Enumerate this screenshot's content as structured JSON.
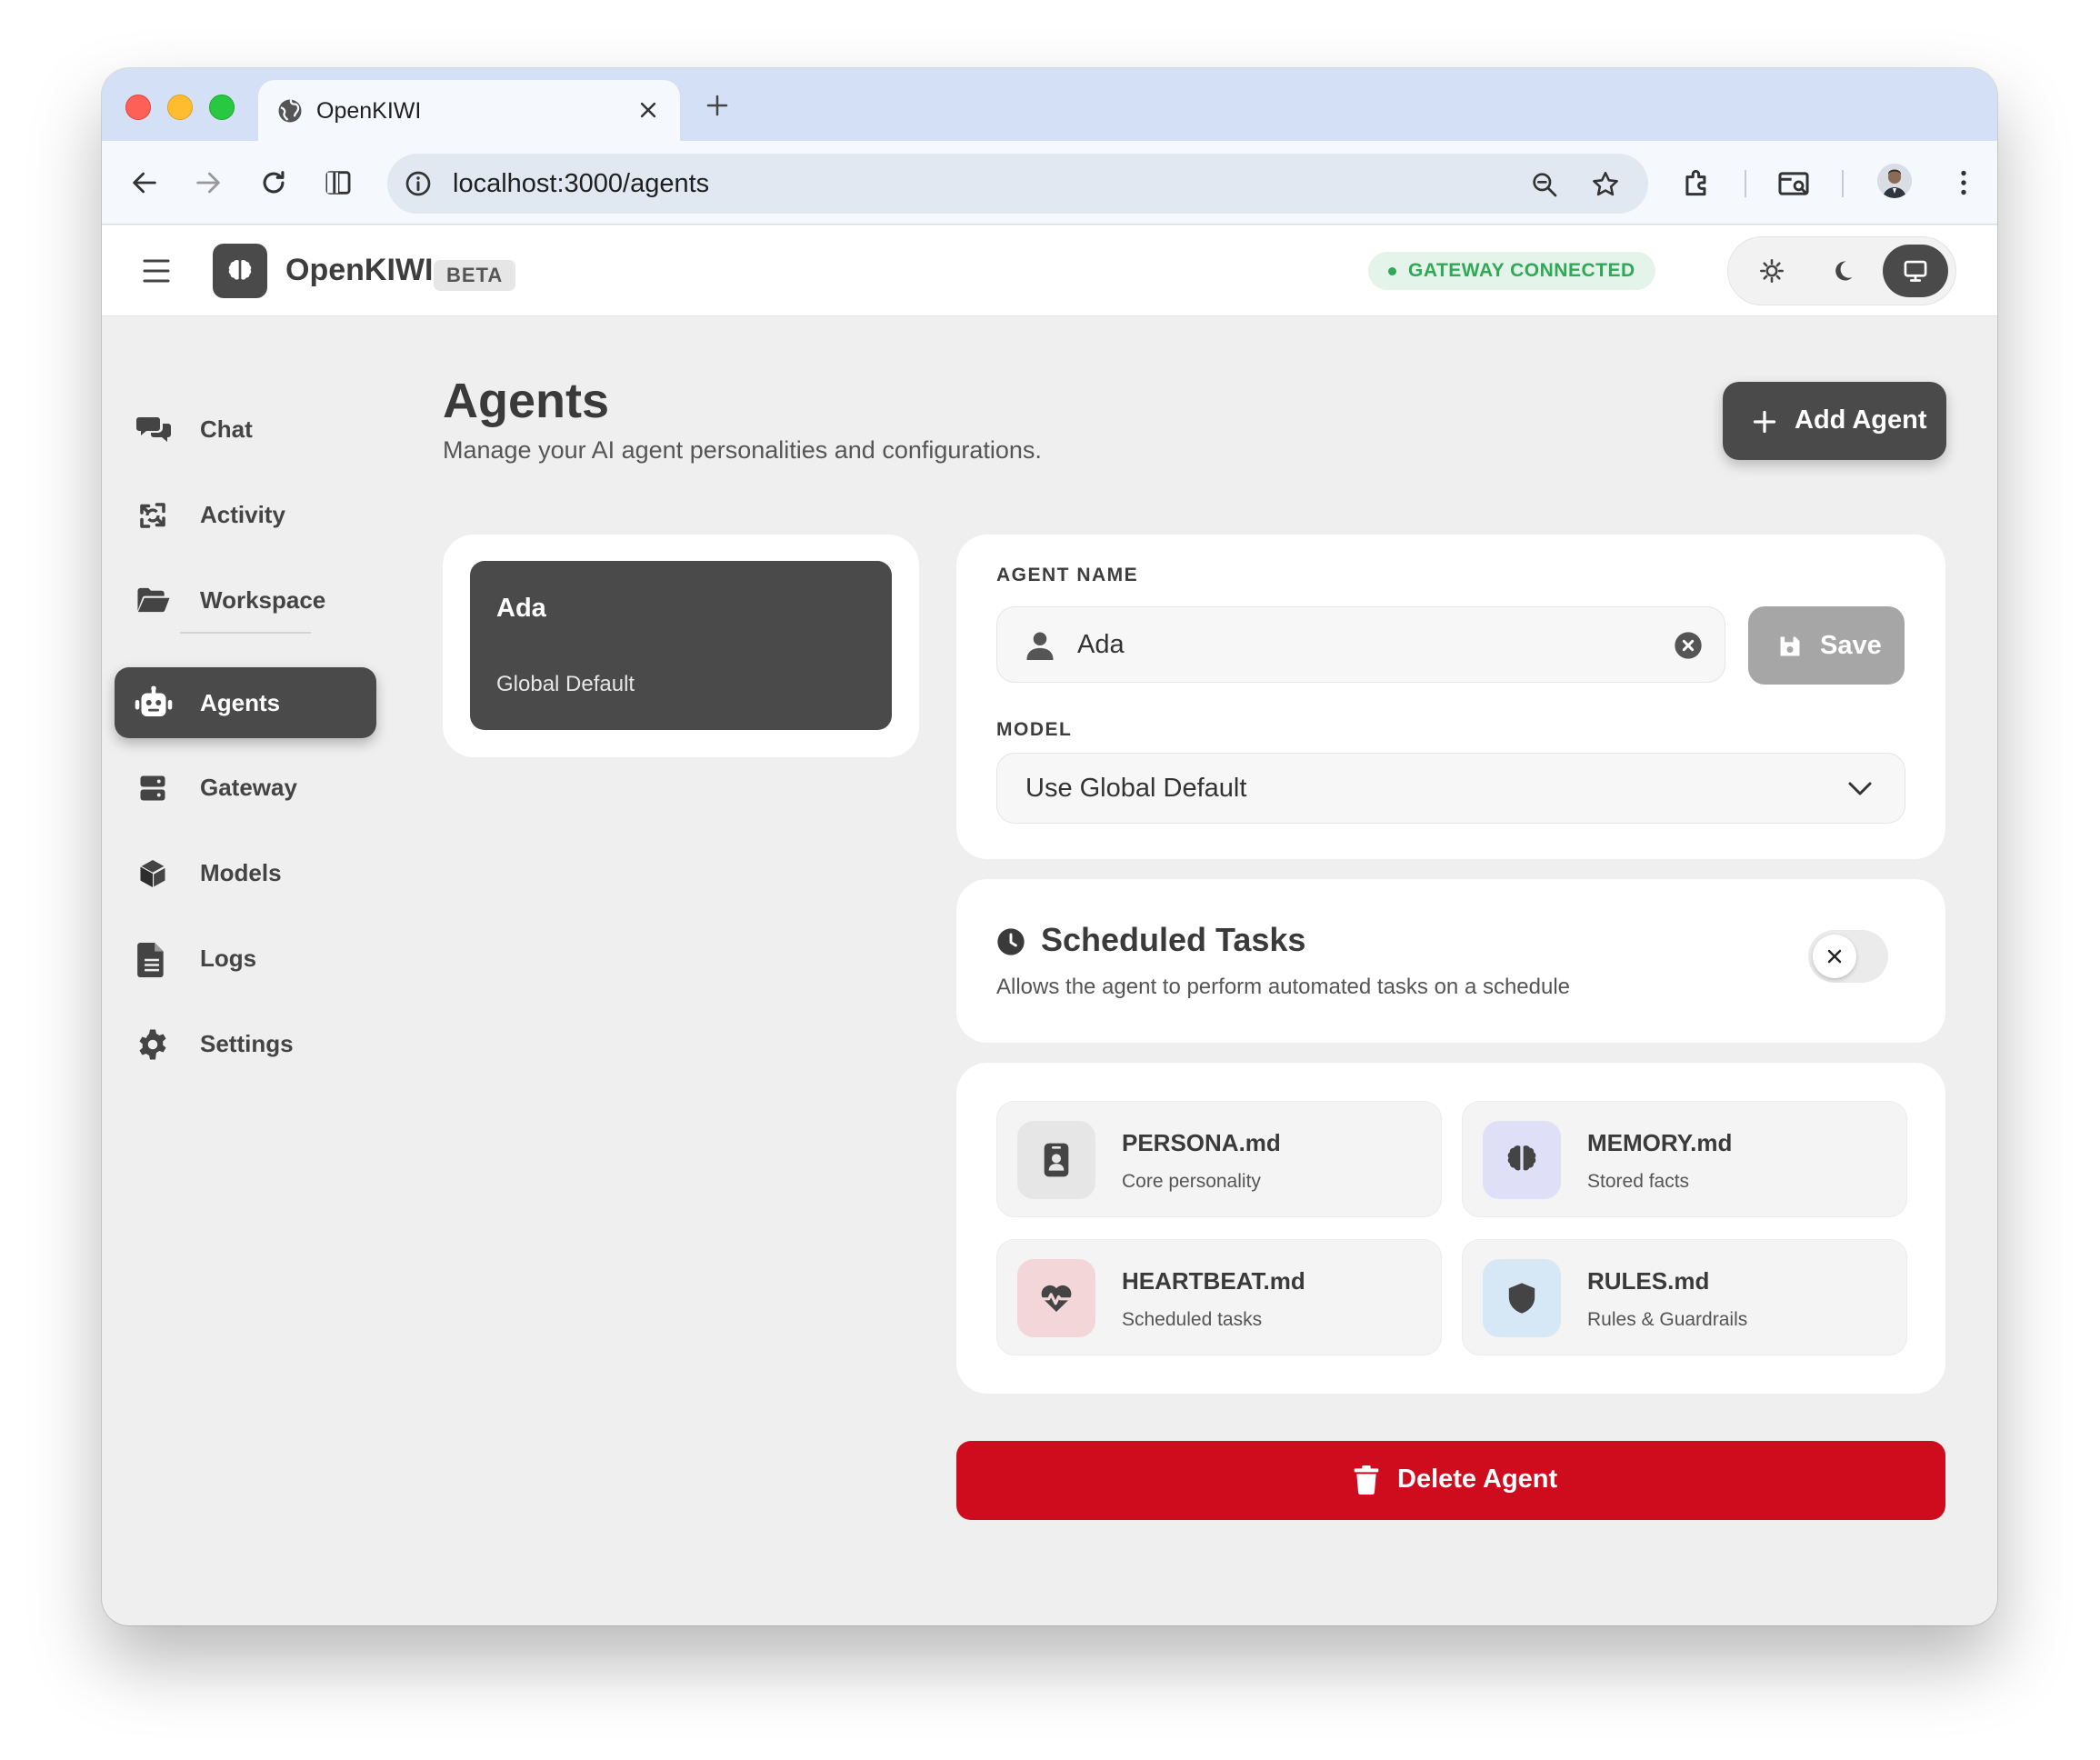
{
  "browser": {
    "tab_title": "OpenKIWI",
    "url": "localhost:3000/agents"
  },
  "header": {
    "brand": "OpenKIWI",
    "beta": "BETA",
    "gateway_status": "GATEWAY CONNECTED",
    "theme_active": "system"
  },
  "sidebar": {
    "items": [
      {
        "label": "Chat",
        "icon": "chat-icon"
      },
      {
        "label": "Activity",
        "icon": "activity-icon"
      },
      {
        "label": "Workspace",
        "icon": "folder-icon"
      },
      {
        "label": "Agents",
        "icon": "robot-icon",
        "active": true
      },
      {
        "label": "Gateway",
        "icon": "server-icon"
      },
      {
        "label": "Models",
        "icon": "cube-icon"
      },
      {
        "label": "Logs",
        "icon": "file-icon"
      },
      {
        "label": "Settings",
        "icon": "gear-icon"
      }
    ]
  },
  "page": {
    "title": "Agents",
    "subtitle": "Manage your AI agent personalities and configurations.",
    "add_button": "Add Agent"
  },
  "agents": [
    {
      "name": "Ada",
      "model": "Global Default",
      "selected": true
    }
  ],
  "form": {
    "name_label": "AGENT NAME",
    "name_value": "Ada",
    "save_label": "Save",
    "model_label": "MODEL",
    "model_value": "Use Global Default"
  },
  "scheduled": {
    "title": "Scheduled Tasks",
    "description": "Allows the agent to perform automated tasks on a schedule",
    "enabled": false
  },
  "files": [
    {
      "name": "PERSONA.md",
      "desc": "Core personality",
      "icon": "id-badge-icon",
      "color": "#e6e6e6"
    },
    {
      "name": "MEMORY.md",
      "desc": "Stored facts",
      "icon": "brain-icon",
      "color": "#dfe0f7"
    },
    {
      "name": "HEARTBEAT.md",
      "desc": "Scheduled tasks",
      "icon": "heartbeat-icon",
      "color": "#f3d6d8"
    },
    {
      "name": "RULES.md",
      "desc": "Rules & Guardrails",
      "icon": "shield-icon",
      "color": "#d6e7f5"
    }
  ],
  "delete_label": "Delete Agent",
  "colors": {
    "accent_dark": "#4a4a4a",
    "danger": "#cf0c1e",
    "success": "#30a957"
  }
}
